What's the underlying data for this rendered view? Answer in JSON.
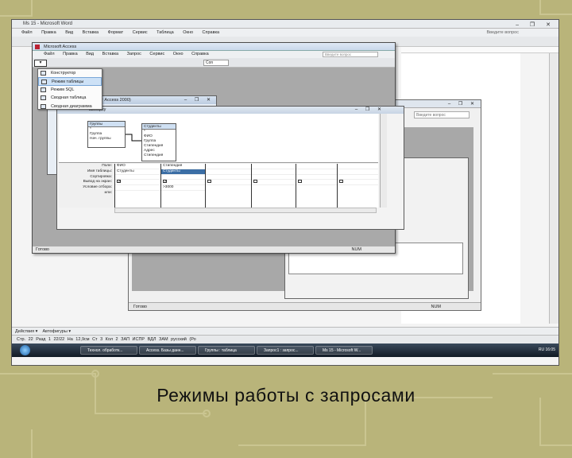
{
  "word": {
    "title": "Ms 15 - Microsoft Word",
    "menu": [
      "Файл",
      "Правка",
      "Вид",
      "Вставка",
      "Формат",
      "Сервис",
      "Таблица",
      "Окно",
      "Справка"
    ],
    "help_placeholder": "Введите вопрос",
    "drawbar_label": "Действия ▾",
    "autoshapes_label": "Автофигуры ▾",
    "statusbar": "Стр. 22   Разд 1   22/22   На 12,9см   Ст 3   Кол 2   ЗАП  ИСПР  ВДЛ  ЗАМ  русский (Ро"
  },
  "access": {
    "title": "Microsoft Access",
    "menu": [
      "Файл",
      "Правка",
      "Вид",
      "Вставка",
      "Запрос",
      "Сервис",
      "Окно",
      "Справка"
    ],
    "search_placeholder": "Введите вопрос",
    "font_box": "Con",
    "status_left": "Готово",
    "status_num": "NUM"
  },
  "view_menu": {
    "items": [
      {
        "label": "Конструктор",
        "icon": "design-view-icon",
        "selected": false
      },
      {
        "label": "Режим таблицы",
        "icon": "datasheet-view-icon",
        "selected": true
      },
      {
        "label": "Режим SQL",
        "icon": "sql-view-icon",
        "selected": false
      },
      {
        "label": "Сводная таблица",
        "icon": "pivot-table-icon",
        "selected": false
      },
      {
        "label": "Сводная диаграмма",
        "icon": "pivot-chart-icon",
        "selected": false
      }
    ]
  },
  "db_window": {
    "title": "формат Access 2000)"
  },
  "query_window": {
    "title": "выборку",
    "tables": [
      {
        "name": "Группы",
        "fields": [
          "*",
          "Группа",
          "Нач. группы"
        ]
      },
      {
        "name": "Студенты",
        "fields": [
          "*",
          "ФИО",
          "Группа",
          "Стипендия",
          "Адрес",
          "Стипендия"
        ]
      }
    ],
    "row_labels": [
      "Поле:",
      "Имя таблицы:",
      "Сортировка:",
      "Вывод на экран:",
      "Условие отбора:",
      "или:"
    ],
    "columns": [
      {
        "field": "ФИО",
        "table": "Студенты",
        "sort": "",
        "show": true,
        "criteria": ""
      },
      {
        "field": "Стипендия",
        "table": "Студенты",
        "sort": "",
        "show": true,
        "criteria": ">3000"
      }
    ],
    "empty_columns": 4
  },
  "back_window": {
    "search_placeholder": "Введите вопрос",
    "status_left": "Готово",
    "status_num": "NUM"
  },
  "taskbar": {
    "tasks": [
      "Технол. обработк...",
      "Access. Базы данн...",
      "Группы : таблица",
      "Запрос1 : запрос...",
      "Ms 15 - Microsoft W..."
    ],
    "tray": "RU  16:05"
  },
  "caption": "Режимы работы с запросами",
  "colors": {
    "background": "#b9b47a",
    "selection": "#3b6ea5",
    "menu_highlight": "#cde1f6"
  }
}
